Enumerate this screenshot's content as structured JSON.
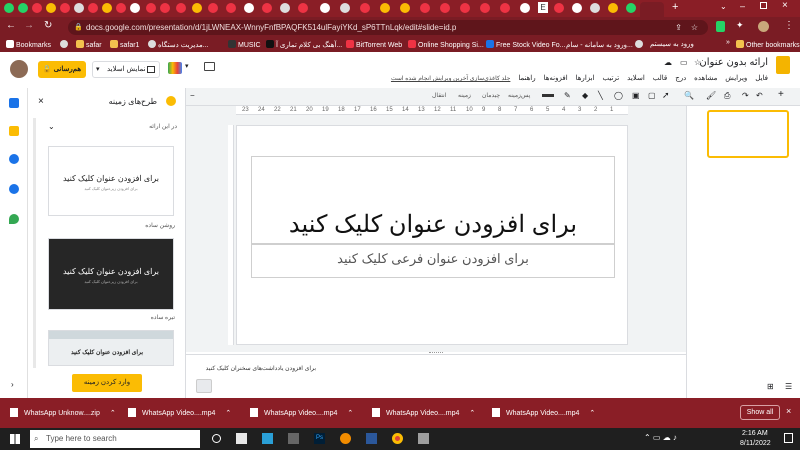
{
  "browser": {
    "url": "docs.google.com/presentation/d/1jLWNEAX-WnnyFnfBPAQFK514ulFayiYKd_sP6TTnLqk/edit#slide=id.p",
    "tab_letter": "E",
    "bookmarks": [
      {
        "label": "Bookmarks"
      },
      {
        "label": "safar"
      },
      {
        "label": "safar1"
      },
      {
        "label": "مدیریت دستگاه..."
      },
      {
        "label": "MUSIC"
      },
      {
        "label": "آهنگ بی کلام تماری آ..."
      },
      {
        "label": "BitTorrent Web"
      },
      {
        "label": "Online Shopping Si..."
      },
      {
        "label": "Free Stock Video Fo..."
      },
      {
        "label": "ورود به سامانه - سام..."
      },
      {
        "label": "ورود به سیستم"
      }
    ],
    "other_bookmarks": "Other bookmarks"
  },
  "slides": {
    "doc_title": "ارائه بدون عنوان",
    "menu": [
      "فایل",
      "ویرایش",
      "مشاهده",
      "درج",
      "قالب",
      "اسلاید",
      "ترتیب",
      "ابزارها",
      "افزونه‌ها",
      "راهنما"
    ],
    "last_edit": "جلد کاغذی‌سازی آخرین ویرایش انجام شده است",
    "share_label": "هم‌رسانی",
    "present_label": "نمایش اسلاید",
    "toolbar": {
      "background": "پس‌زمینه",
      "layout": "چیدمان",
      "theme": "زمینه",
      "transition": "انتقال"
    }
  },
  "themes_panel": {
    "title": "طرح‌های زمینه",
    "section_label": "در این ارائه",
    "cards": [
      {
        "title": "برای افزودن عنوان کلیک کنید",
        "subtitle": "برای افزودن زیرعنوان کلیک کنید",
        "name": "روشن ساده",
        "style": "light"
      },
      {
        "title": "برای افزودن عنوان کلیک کنید",
        "subtitle": "برای افزودن زیرعنوان کلیک کنید",
        "name": "تیره ساده",
        "style": "dark"
      },
      {
        "title": "برای افزودن عنوان کلیک کنید",
        "subtitle": "",
        "name": "",
        "style": "streamline"
      }
    ],
    "import_button": "وارد کردن زمینه"
  },
  "ruler_ticks": [
    "23",
    "24",
    "22",
    "21",
    "20",
    "19",
    "18",
    "17",
    "16",
    "15",
    "14",
    "13",
    "12",
    "11",
    "10",
    "9",
    "8",
    "7",
    "6",
    "5",
    "4",
    "3",
    "2",
    "1"
  ],
  "slide": {
    "title": "برای افزودن عنوان کلیک کنید",
    "subtitle": "برای افزودن عنوان فرعی کلیک کنید"
  },
  "notes_placeholder": "برای افزودن یادداشت‌های سخنران کلیک کنید",
  "downloads": {
    "items": [
      {
        "name": "WhatsApp Unknow....zip"
      },
      {
        "name": "WhatsApp Video....mp4"
      },
      {
        "name": "WhatsApp Video....mp4"
      },
      {
        "name": "WhatsApp Video....mp4"
      },
      {
        "name": "WhatsApp Video....mp4"
      }
    ],
    "show_all": "Show all"
  },
  "taskbar": {
    "search_placeholder": "Type here to search",
    "time": "2:16 AM",
    "date": "8/11/2022"
  },
  "colors": {
    "chrome_frame": "#8a1e26",
    "share_yellow": "#fbbc04",
    "dark_theme": "#262626"
  }
}
